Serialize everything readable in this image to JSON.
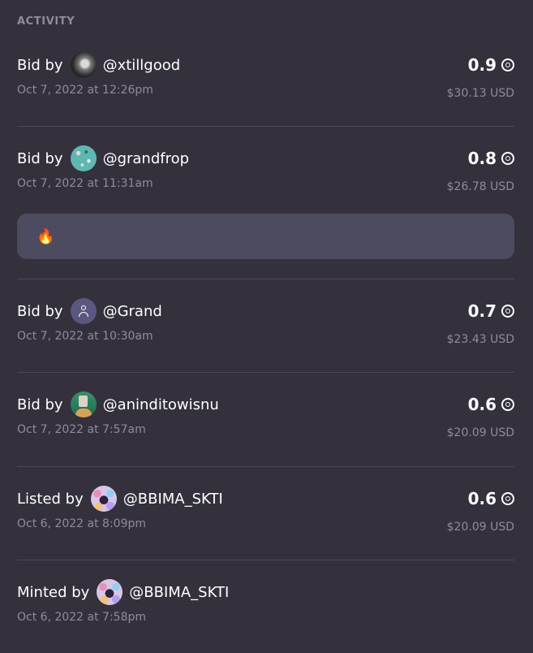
{
  "section_title": "ACTIVITY",
  "items": [
    {
      "verb": "Bid by",
      "handle": "@xtillgood",
      "avatar": "grayscale-avatar",
      "date": "Oct 7, 2022 at 12:26pm",
      "amount": "0.9",
      "usd": "$30.13 USD"
    },
    {
      "verb": "Bid by",
      "handle": "@grandfrop",
      "avatar": "teal-pattern-avatar",
      "date": "Oct 7, 2022 at 11:31am",
      "amount": "0.8",
      "usd": "$26.78 USD",
      "comment": "🔥"
    },
    {
      "verb": "Bid by",
      "handle": "@Grand",
      "avatar": "default-user-avatar",
      "date": "Oct 7, 2022 at 10:30am",
      "amount": "0.7",
      "usd": "$23.43 USD"
    },
    {
      "verb": "Bid by",
      "handle": "@aninditowisnu",
      "avatar": "character-avatar",
      "date": "Oct 7, 2022 at 7:57am",
      "amount": "0.6",
      "usd": "$20.09 USD"
    },
    {
      "verb": "Listed by",
      "handle": "@BBIMA_SKTI",
      "avatar": "colorful-avatar",
      "date": "Oct 6, 2022 at 8:09pm",
      "amount": "0.6",
      "usd": "$20.09 USD"
    },
    {
      "verb": "Minted by",
      "handle": "@BBIMA_SKTI",
      "avatar": "colorful-avatar",
      "date": "Oct 6, 2022 at 7:58pm"
    }
  ],
  "currency_icon": "tezos-coin-icon",
  "colors": {
    "background": "#34313d",
    "muted_text": "#8f8b9d",
    "divider": "#4d4a58",
    "comment_bg": "#4d4b5f"
  }
}
